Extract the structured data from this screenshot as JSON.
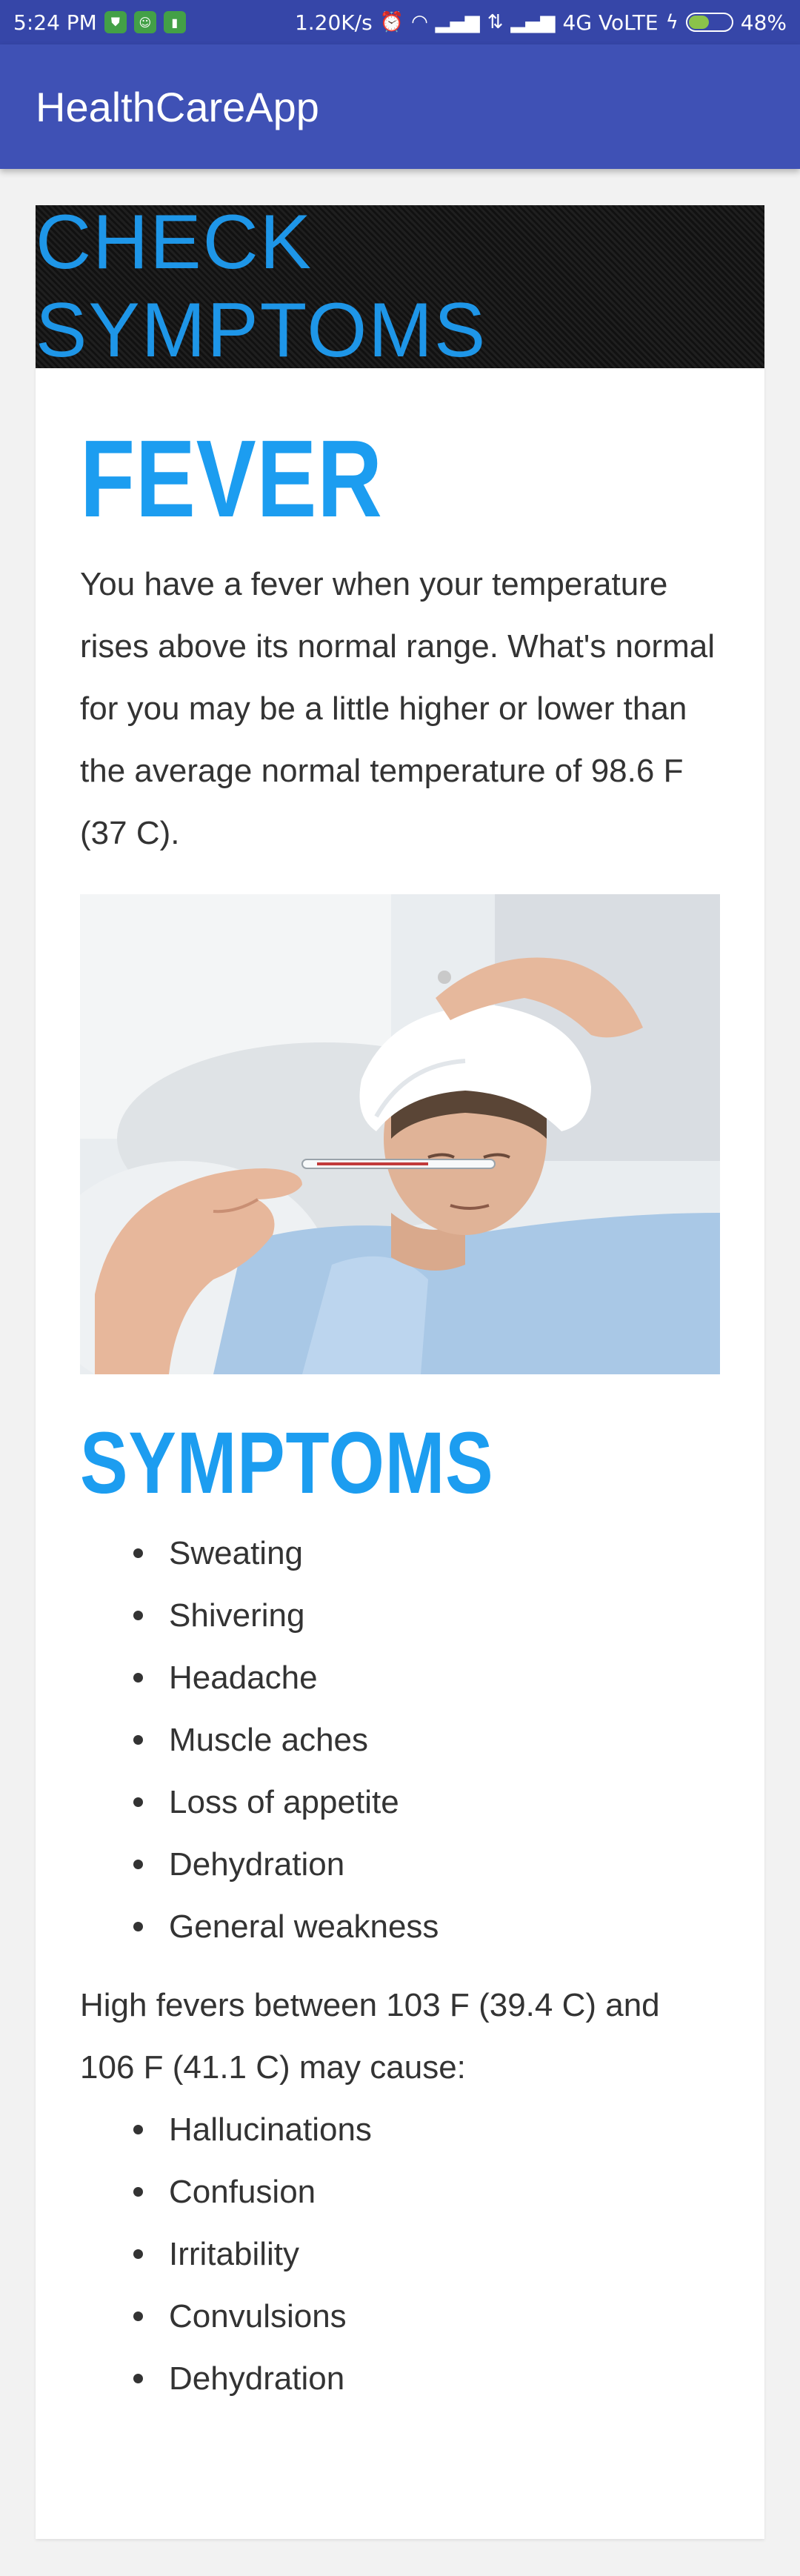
{
  "status_bar": {
    "time": "5:24 PM",
    "net_speed": "1.20K/s",
    "network": "4G VoLTE",
    "battery_percent": "48%",
    "battery_level": 0.48
  },
  "app_bar": {
    "title": "HealthCareApp"
  },
  "banner": {
    "text": "CHECK SYMPTOMS"
  },
  "article": {
    "title": "FEVER",
    "intro": "You have a fever when your temperature rises above its normal range. What's normal for you may be a little higher or lower than the average normal temperature of 98.6 F (37 C).",
    "symptoms_heading": "SYMPTOMS",
    "symptoms": [
      "Sweating",
      "Shivering",
      "Headache",
      "Muscle aches",
      "Loss of appetite",
      "Dehydration",
      "General weakness"
    ],
    "high_fever_text": "High fevers between 103 F (39.4 C) and 106 F (41.1 C) may cause:",
    "high_fever_effects": [
      "Hallucinations",
      "Confusion",
      "Irritability",
      "Convulsions",
      "Dehydration"
    ]
  },
  "colors": {
    "app_bar": "#3f51b5",
    "status_bar": "#3646a8",
    "accent_heading": "#1c9df0",
    "banner_text": "#1e96e8"
  }
}
